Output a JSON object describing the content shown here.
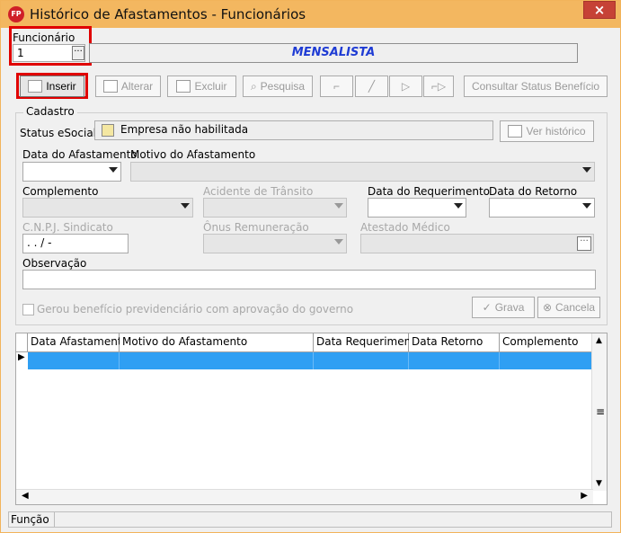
{
  "window": {
    "title": "Histórico de Afastamentos - Funcionários",
    "app_badge": "FP",
    "close_symbol": "×"
  },
  "employee": {
    "label": "Funcionário",
    "value": "1",
    "lookup_symbol": "···",
    "banner": "MENSALISTA"
  },
  "toolbar": {
    "insert": "Inserir",
    "edit": "Alterar",
    "delete": "Excluir",
    "search": "Pesquisa",
    "first": "⌐",
    "previous": "╱",
    "next": "▷",
    "last": "⌐▷",
    "consult": "Consultar Status Benefício"
  },
  "cadastro": {
    "caption": "Cadastro",
    "status_label": "Status eSocial:",
    "status_value": "Empresa não habilitada",
    "history_button": "Ver histórico",
    "fields": {
      "data_afastamento": "Data do Afastamento",
      "motivo_afastamento": "Motivo do Afastamento",
      "complemento": "Complemento",
      "acidente_transito": "Acidente de Trânsito",
      "data_requerimento": "Data do Requerimento",
      "data_retorno": "Data do Retorno",
      "cnpj_sindicato": "C.N.P.J. Sindicato",
      "onus_remuneracao": "Ônus Remuneração",
      "atestado_medico": "Atestado Médico",
      "observacao": "Observação"
    },
    "cnpj_placeholder": "  .  .  /   -",
    "atestado_lookup": "···",
    "checkbox_label": "Gerou benefício previdenciário com aprovação do governo",
    "save_button": "Grava",
    "cancel_button": "Cancela"
  },
  "grid": {
    "columns": [
      "Data Afastamento",
      "Motivo do Afastamento",
      "Data Requerimento",
      "Data Retorno",
      "Complemento"
    ],
    "selected_row_marker": "▶"
  },
  "footer": {
    "function_label": "Função"
  },
  "colors": {
    "title_bar": "#f3b760",
    "highlight": "#e00000",
    "banner_text": "#1f3cd4",
    "selection": "#2f9ff3"
  }
}
